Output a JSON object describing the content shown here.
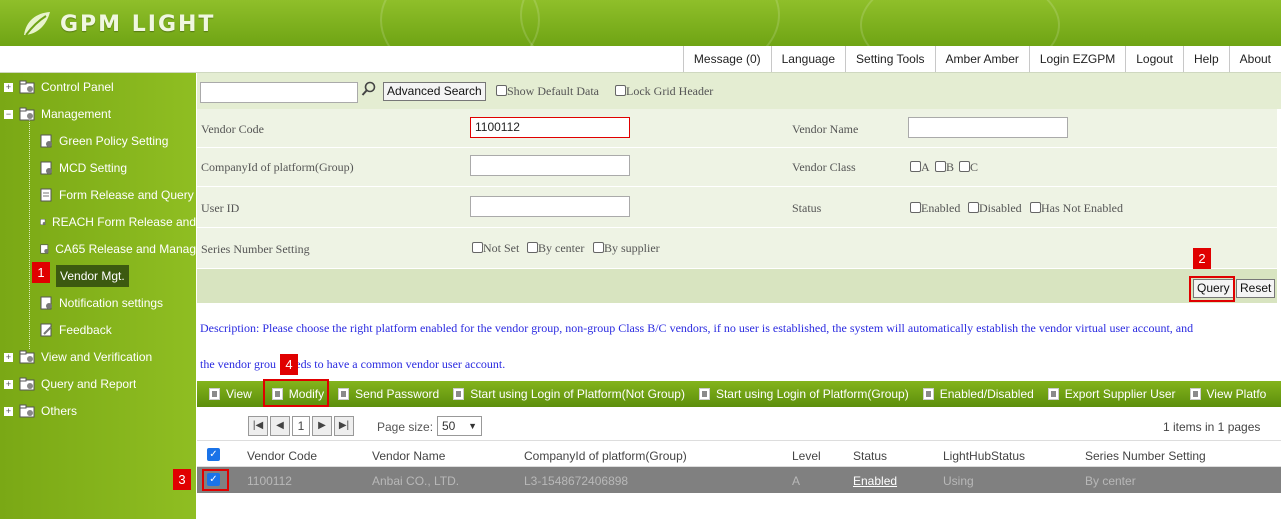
{
  "app": {
    "logo_text": "GPM LIGHT"
  },
  "topnav": [
    "Message (0)",
    "Language",
    "Setting Tools",
    "Amber Amber",
    "Login EZGPM",
    "Logout",
    "Help",
    "About"
  ],
  "sidebar": {
    "control_panel": "Control Panel",
    "management": "Management",
    "green_policy": "Green Policy Setting",
    "mcd": "MCD Setting",
    "form_release": "Form Release and Query",
    "reach": "REACH Form Release and",
    "ca65": "CA65 Release and Manag",
    "vendor_mgt": "Vendor Mgt.",
    "notification": "Notification settings",
    "feedback": "Feedback",
    "view_verification": "View and Verification",
    "query_report": "Query and Report",
    "others": "Others"
  },
  "search": {
    "value": "",
    "advanced_label": "Advanced Search",
    "show_default": "Show Default Data",
    "lock_header": "Lock Grid Header"
  },
  "form": {
    "vendor_code_label": "Vendor Code",
    "vendor_code_value": "1100112",
    "vendor_name_label": "Vendor Name",
    "vendor_name_value": "",
    "companyid_label": "CompanyId of platform(Group)",
    "companyid_value": "",
    "vendor_class_label": "Vendor Class",
    "class_a": "A",
    "class_b": "B",
    "class_c": "C",
    "user_id_label": "User ID",
    "user_id_value": "",
    "status_label": "Status",
    "status_enabled": "Enabled",
    "status_disabled": "Disabled",
    "status_not_enabled": "Has Not Enabled",
    "series_label": "Series Number Setting",
    "series_not_set": "Not Set",
    "series_center": "By center",
    "series_supplier": "By supplier"
  },
  "actions": {
    "query": "Query",
    "reset": "Reset"
  },
  "description": {
    "line1": "Description: Please choose the right platform enabled for the vendor group, non-group Class B/C vendors, if no user is established, the system will automatically establish the vendor virtual user account, and",
    "line2_a": "the vendor grou",
    "line2_b": "eeds to have a common vendor user account."
  },
  "toolbar": [
    "View",
    "Modify",
    "Send Password",
    "Start using Login of Platform(Not Group)",
    "Start using Login of Platform(Group)",
    "Enabled/Disabled",
    "Export Supplier User",
    "View Platfo"
  ],
  "pager": {
    "page": "1",
    "page_size_label": "Page size:",
    "page_size": "50",
    "info": "1 items in 1 pages"
  },
  "grid": {
    "columns": [
      "Vendor Code",
      "Vendor Name",
      "CompanyId of platform(Group)",
      "Level",
      "Status",
      "LightHubStatus",
      "Series Number Setting"
    ],
    "rows": [
      [
        "1100112",
        "Anbai CO., LTD.",
        "L3-1548672406898",
        "A",
        "Enabled",
        "Using",
        "By center"
      ]
    ]
  },
  "annotations": [
    "1",
    "2",
    "3",
    "4"
  ],
  "colors": {
    "accent": "#7aa815",
    "annotation": "#e00000",
    "description": "#2a2ae0"
  }
}
